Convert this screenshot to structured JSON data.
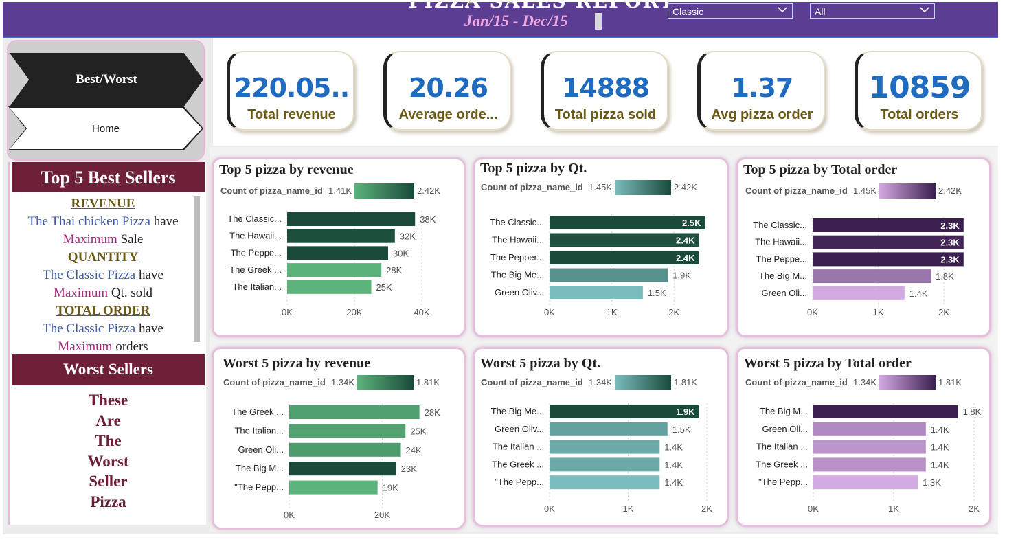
{
  "header": {
    "title": "PIZZA SALES REPORT",
    "date_range": "Jan/15 - Dec/15",
    "slicers": [
      {
        "value": "Classic"
      },
      {
        "value": "All"
      }
    ]
  },
  "nav": {
    "best_worst_label": "Best/Worst",
    "home_label": "Home"
  },
  "kpis": [
    {
      "value": "220.05..",
      "label": "Total revenue"
    },
    {
      "value": "20.26",
      "label": "Average orde..."
    },
    {
      "value": "14888",
      "label": "Total pizza sold"
    },
    {
      "value": "1.37",
      "label": "Avg pizza order"
    },
    {
      "value": "10859",
      "label": "Total orders"
    }
  ],
  "left_panel": {
    "best_title": "Top 5 Best Sellers",
    "worst_title": "Worst Sellers",
    "insights": {
      "revenue_heading": "REVENUE",
      "revenue_pizza": "The Thai chicken Pizza",
      "have1": " have",
      "maximum1": "Maximum",
      "sale": " Sale",
      "quantity_heading": "QUANTITY",
      "quantity_pizza": "The Classic Pizza",
      "have2": " have",
      "maximum2": "Maximum",
      "qt_sold": " Qt. sold",
      "order_heading": "TOTAL ORDER",
      "order_pizza": "The Classic Pizza",
      "have3": " have",
      "maximum3": "Maximum",
      "orders": " orders"
    },
    "worst_text": [
      "These",
      "Are",
      "The",
      "Worst",
      "Seller",
      "Pizza"
    ]
  },
  "colors": {
    "header_bg": "#5b3d92",
    "band_bg": "#6e2038",
    "kpi_value": "#1e6bc0",
    "kpi_label": "#6b5a14",
    "green_dark": "#1a4a3a",
    "green_light": "#5cb37b",
    "teal_dark": "#1a4a3a",
    "teal_light": "#7bbcbe",
    "purple_dark": "#3b1f4e",
    "purple_light": "#d3a9e2"
  },
  "chart_data": [
    {
      "type": "bar",
      "title": "Top 5 pizza by revenue",
      "legend_field": "Count of pizza_name_id",
      "legend_min": "1.41K",
      "legend_max": "2.42K",
      "palette": "green",
      "categories": [
        "The Classic...",
        "The Hawaii...",
        "The Peppe...",
        "The Greek ...",
        "The Italian..."
      ],
      "values": [
        38,
        32,
        30,
        28,
        25
      ],
      "color_values": [
        2.42,
        2.37,
        2.42,
        1.42,
        1.41
      ],
      "value_labels": [
        "38K",
        "32K",
        "30K",
        "28K",
        "25K"
      ],
      "ticks": [
        "0K",
        "20K",
        "40K"
      ],
      "tick_values": [
        0,
        20,
        40
      ],
      "xlim": [
        0,
        40
      ]
    },
    {
      "type": "bar",
      "title": "Top 5 pizza by Qt.",
      "legend_field": "Count of pizza_name_id",
      "legend_min": "1.45K",
      "legend_max": "2.42K",
      "palette": "teal",
      "categories": [
        "The Classic...",
        "The Hawaii...",
        "The Pepper...",
        "The Big Me...",
        "Green Oliv..."
      ],
      "values": [
        2.5,
        2.4,
        2.4,
        1.9,
        1.5
      ],
      "color_values": [
        2.42,
        2.37,
        2.42,
        1.81,
        1.45
      ],
      "value_labels": [
        "2.5K",
        "2.4K",
        "2.4K",
        "1.9K",
        "1.5K"
      ],
      "ticks": [
        "0K",
        "1K",
        "2K"
      ],
      "tick_values": [
        0,
        1,
        2
      ],
      "xlim": [
        0,
        2.45
      ]
    },
    {
      "type": "bar",
      "title": "Top 5 pizza by Total order",
      "legend_field": "Count of pizza_name_id",
      "legend_min": "1.45K",
      "legend_max": "2.42K",
      "palette": "purple",
      "categories": [
        "The Classic...",
        "The Hawaii...",
        "The Peppe...",
        "The Big M...",
        "Green Oli..."
      ],
      "values": [
        2.3,
        2.3,
        2.3,
        1.8,
        1.4
      ],
      "color_values": [
        2.42,
        2.37,
        2.42,
        1.81,
        1.45
      ],
      "value_labels": [
        "2.3K",
        "2.3K",
        "2.3K",
        "1.8K",
        "1.4K"
      ],
      "ticks": [
        "0K",
        "1K",
        "2K"
      ],
      "tick_values": [
        0,
        1,
        2
      ],
      "xlim": [
        0,
        2.25
      ]
    },
    {
      "type": "bar",
      "title": "Worst 5 pizza by revenue",
      "legend_field": "Count of pizza_name_id",
      "legend_min": "1.34K",
      "legend_max": "1.81K",
      "palette": "green",
      "categories": [
        "The Greek ...",
        "The Italian...",
        "Green Oli...",
        "The Big M...",
        "\"The Pepp..."
      ],
      "values": [
        28,
        25,
        24,
        23,
        19
      ],
      "color_values": [
        1.42,
        1.41,
        1.45,
        1.81,
        1.34
      ],
      "value_labels": [
        "28K",
        "25K",
        "24K",
        "23K",
        "19K"
      ],
      "ticks": [
        "0K",
        "20K"
      ],
      "tick_values": [
        0,
        20
      ],
      "xlim": [
        0,
        28.5
      ]
    },
    {
      "type": "bar",
      "title": "Worst 5 pizza by Qt.",
      "legend_field": "Count of pizza_name_id",
      "legend_min": "1.34K",
      "legend_max": "1.81K",
      "palette": "teal",
      "categories": [
        "The Big Me...",
        "Green Oliv...",
        "The Italian ...",
        "The Greek ...",
        "\"The Pepp..."
      ],
      "values": [
        1.9,
        1.5,
        1.4,
        1.4,
        1.4
      ],
      "color_values": [
        1.81,
        1.45,
        1.41,
        1.42,
        1.34
      ],
      "value_labels": [
        "1.9K",
        "1.5K",
        "1.4K",
        "1.4K",
        "1.4K"
      ],
      "ticks": [
        "0K",
        "1K",
        "2K"
      ],
      "tick_values": [
        0,
        1,
        2
      ],
      "xlim": [
        0,
        2
      ]
    },
    {
      "type": "bar",
      "title": "Worst 5 pizza by Total order",
      "legend_field": "Count of pizza_name_id",
      "legend_min": "1.34K",
      "legend_max": "1.81K",
      "palette": "purple",
      "categories": [
        "The Big M...",
        "Green Oli...",
        "The Italian ...",
        "The Greek ...",
        "\"The Pepp..."
      ],
      "values": [
        1.8,
        1.4,
        1.4,
        1.4,
        1.3
      ],
      "color_values": [
        1.81,
        1.45,
        1.41,
        1.42,
        1.34
      ],
      "value_labels": [
        "1.8K",
        "1.4K",
        "1.4K",
        "1.4K",
        "1.3K"
      ],
      "ticks": [
        "0K",
        "1K",
        "2K"
      ],
      "tick_values": [
        0,
        1,
        2
      ],
      "xlim": [
        0,
        2
      ]
    }
  ]
}
